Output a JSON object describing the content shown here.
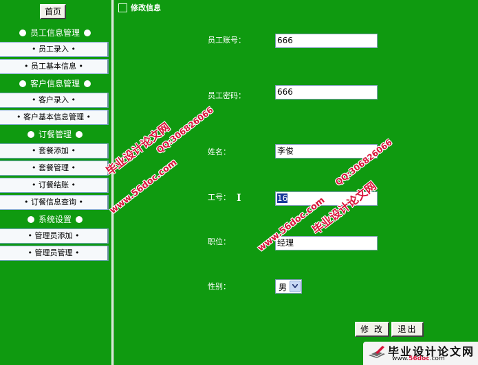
{
  "sidebar": {
    "home_label": "首页",
    "sections": [
      {
        "label": "员工信息管理",
        "items": [
          "• 员工录入 •",
          "• 员工基本信息 •"
        ]
      },
      {
        "label": "客户信息管理",
        "items": [
          "• 客户录入 •",
          "• 客户基本信息管理 •"
        ]
      },
      {
        "label": "订餐管理",
        "items": [
          "• 套餐添加 •",
          "• 套餐管理 •",
          "• 订餐结账 •",
          "• 订餐信息查询 •"
        ]
      },
      {
        "label": "系统设置",
        "items": [
          "• 管理员添加 •",
          "• 管理员管理 •"
        ]
      }
    ]
  },
  "main": {
    "title": "修改信息",
    "fields": {
      "account": {
        "label": "员工账号：",
        "value": "666"
      },
      "password": {
        "label": "员工密码：",
        "value": "666"
      },
      "name": {
        "label": "姓名：",
        "value": "李俊"
      },
      "job_no": {
        "label": "工号：",
        "value": "16"
      },
      "position": {
        "label": "职位：",
        "value": "经理"
      },
      "gender": {
        "label": "性别：",
        "value": "男"
      }
    },
    "modify_label": "修 改",
    "exit_label": "退出"
  },
  "watermarks": {
    "site_name": "毕业设计论文网",
    "url": "www.56doc.com",
    "qq": "QQ:306826066"
  },
  "footer_logo": {
    "title": "毕业设计论文网",
    "url_prefix": "www.",
    "url_main": "56doc",
    "url_suffix": ".com",
    "icon": "pen-book-icon"
  },
  "colors": {
    "background": "#0f9a10",
    "watermark": "#d8143a",
    "menu_item_bg": "#f6f9fb"
  }
}
